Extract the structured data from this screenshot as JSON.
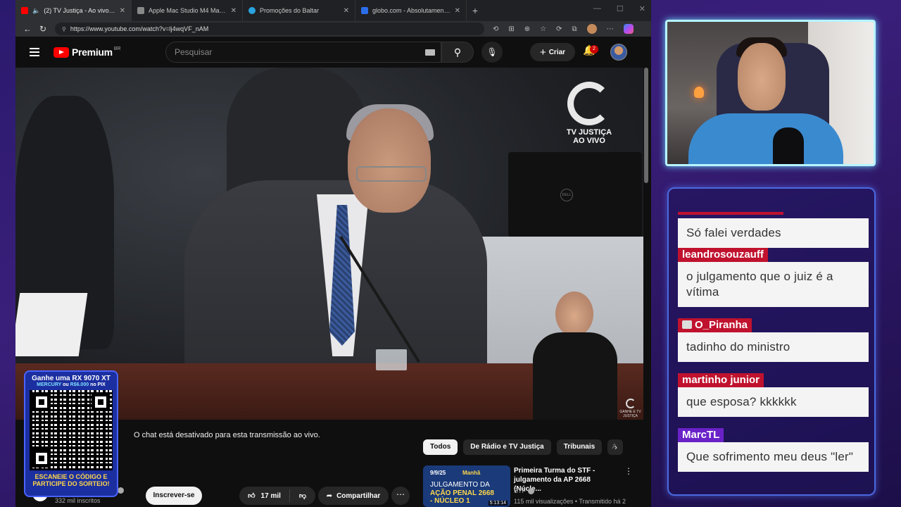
{
  "browser": {
    "tabs": [
      {
        "title": "(2) TV Justiça - Ao vivo - You",
        "active": true,
        "favicon_color": "#ff0000"
      },
      {
        "title": "Apple Mac Studio M4 Max 16-co",
        "active": false,
        "favicon_color": "#888888"
      },
      {
        "title": "Promoções do Baltar",
        "active": false,
        "favicon_color": "#2aa3e0"
      },
      {
        "title": "globo.com - Absolutamente tudo",
        "active": false,
        "favicon_color": "#2b6de8"
      }
    ],
    "url": "https://www.youtube.com/watch?v=lj4wqVF_nAM",
    "new_tab": "+",
    "win_controls": {
      "minimize": "—",
      "maximize": "☐",
      "close": "✕"
    }
  },
  "youtube": {
    "logo_text": "Premium",
    "logo_region": "BR",
    "search_placeholder": "Pesquisar",
    "create_label": "Criar",
    "notification_count": "2",
    "video_overlay": {
      "channel_logo_line1": "TV JUSTIÇA",
      "channel_logo_line2": "AO VIVO",
      "corner_mark": "GANHE E TV JUSTIÇA"
    },
    "chat_disabled": "O chat está desativado para esta transmissão ao vivo.",
    "subscribers": "332 mil inscritos",
    "channel_name_partial": "a",
    "subscribe_label": "Inscrever-se",
    "likes": "17 mil",
    "share_label": "Compartilhar",
    "chips": [
      "Todos",
      "De Rádio e TV Justiça",
      "Tribunais",
      "A"
    ],
    "recommendation": {
      "thumb_date": "9/9/25",
      "thumb_tag": "Manhã",
      "thumb_line1": "JULGAMENTO DA",
      "thumb_line2": "AÇÃO PENAL 2668",
      "thumb_line3": "- NÚCLEO 1",
      "duration": "5:13:14",
      "title": "Primeira Turma do STF - julgamento da AP 2668 (Núcle...",
      "channel": "STF",
      "meta": "115 mil visualizações • Transmitido há 2"
    }
  },
  "qr_promo": {
    "line1": "Ganhe uma RX 9070 XT",
    "line2a": "MERCURY",
    "line2b": "ou",
    "line2c": "R$6.000",
    "line2d": "no PIX",
    "line3": "ESCANEIE O CÓDIGO E",
    "line4": "PARTICIPE DO SORTEIO!"
  },
  "chat": {
    "messages": [
      {
        "user": "",
        "text": "Só falei verdades",
        "color": "red"
      },
      {
        "user": "leandrosouzauff",
        "text": "o julgamento que o juiz é a vítima",
        "color": "red"
      },
      {
        "user": "O_Piranha",
        "text": "tadinho do ministro",
        "color": "red"
      },
      {
        "user": "martinho junior",
        "text": "que esposa? kkkkkk",
        "color": "red"
      },
      {
        "user": "MarcTL",
        "text": "Que sofrimento meu deus \"ler\"",
        "color": "purple"
      }
    ]
  },
  "colors": {
    "youtube_red": "#ff0000",
    "chat_red": "#c0122e",
    "chat_purple": "#6a22c8",
    "webcam_border": "#b8f4ff"
  }
}
